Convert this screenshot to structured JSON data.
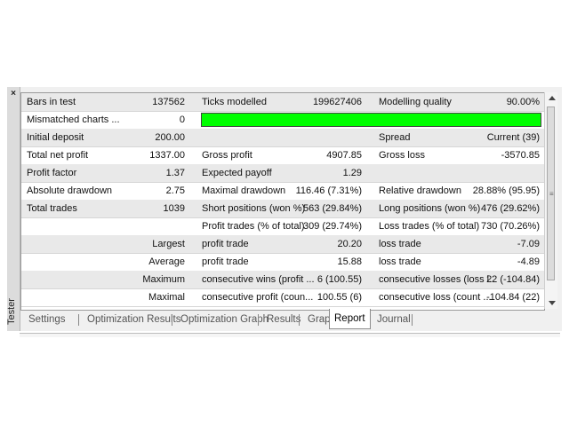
{
  "window": {
    "panel_label": "Tester",
    "close_glyph": "×"
  },
  "report": {
    "rows": [
      {
        "c1": "Bars in test",
        "c2": "137562",
        "c3": "Ticks modelled",
        "c4": "199627406",
        "c5": "Modelling quality",
        "c6": "90.00%"
      },
      {
        "c1": "Mismatched charts ...",
        "c2": "0"
      },
      {
        "c1": "Initial deposit",
        "c2": "200.00",
        "c5": "Spread",
        "c6": "Current (39)"
      },
      {
        "c1": "Total net profit",
        "c2": "1337.00",
        "c3": "Gross profit",
        "c4": "4907.85",
        "c5": "Gross loss",
        "c6": "-3570.85"
      },
      {
        "c1": "Profit factor",
        "c2": "1.37",
        "c3": "Expected payoff",
        "c4": "1.29"
      },
      {
        "c1": "Absolute drawdown",
        "c2": "2.75",
        "c3": "Maximal drawdown",
        "c4": "116.46 (7.31%)",
        "c5": "Relative drawdown",
        "c6": "28.88% (95.95)"
      },
      {
        "c1": "Total trades",
        "c2": "1039",
        "c3": "Short positions (won %)",
        "c4": "563 (29.84%)",
        "c5": "Long positions (won %)",
        "c6": "476 (29.62%)"
      },
      {
        "c3": "Profit trades (% of total)",
        "c4": "309 (29.74%)",
        "c5": "Loss trades (% of total)",
        "c6": "730 (70.26%)"
      },
      {
        "c2": "Largest",
        "c3": "profit trade",
        "c4": "20.20",
        "c5": "loss trade",
        "c6": "-7.09"
      },
      {
        "c2": "Average",
        "c3": "profit trade",
        "c4": "15.88",
        "c5": "loss trade",
        "c6": "-4.89"
      },
      {
        "c2": "Maximum",
        "c3": "consecutive wins (profit ...",
        "c4": "6 (100.55)",
        "c5": "consecutive losses (loss i...",
        "c6": "22 (-104.84)"
      },
      {
        "c2": "Maximal",
        "c3": "consecutive profit (coun...",
        "c4": "100.55 (6)",
        "c5": "consecutive loss (count ...",
        "c6": "-104.84 (22)"
      }
    ],
    "modelling_quality_fraction": 0.9,
    "bar_color": "#00ff00"
  },
  "tabs": [
    {
      "label": "Settings",
      "active": false
    },
    {
      "label": "Optimization Results",
      "active": false
    },
    {
      "label": "Optimization Graph",
      "active": false
    },
    {
      "label": "Results",
      "active": false
    },
    {
      "label": "Graph",
      "active": false
    },
    {
      "label": "Report",
      "active": true
    },
    {
      "label": "Journal",
      "active": false
    }
  ]
}
